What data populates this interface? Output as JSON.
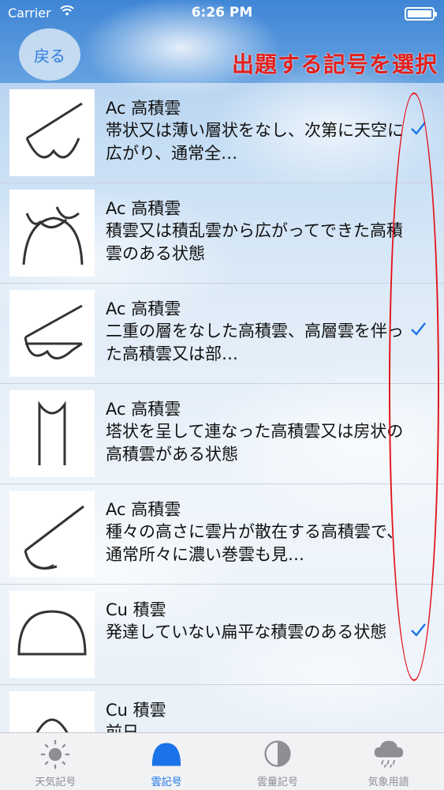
{
  "status_bar": {
    "carrier": "Carrier",
    "time": "6:26 PM",
    "battery_level": 1.0
  },
  "header": {
    "back_label": "戻る",
    "title": "出題する記号を選択"
  },
  "colors": {
    "accent": "#1a73e8",
    "title_red": "#e3201b",
    "oval_red": "#e3141a"
  },
  "items": [
    {
      "symbol": "ac-band-icon",
      "title": "Ac 高積雲",
      "description": "帯状又は薄い層状をなし、次第に天空に広がり、通常全…",
      "checked": true
    },
    {
      "symbol": "ac-from-cumulus-icon",
      "title": "Ac 高積雲",
      "description": "積雲又は積乱雲から広がってできた高積雲のある状態",
      "checked": false
    },
    {
      "symbol": "ac-double-layer-icon",
      "title": "Ac 高積雲",
      "description": "二重の層をなした高積雲、高層雲を伴った高積雲又は部…",
      "checked": true
    },
    {
      "symbol": "ac-castellanus-icon",
      "title": "Ac 高積雲",
      "description": "塔状を呈して連なった高積雲又は房状の高積雲がある状態",
      "checked": false
    },
    {
      "symbol": "ac-chaotic-icon",
      "title": "Ac 高積雲",
      "description": "種々の高さに雲片が散在する高積雲で、通常所々に濃い巻雲も見…",
      "checked": false
    },
    {
      "symbol": "cu-flat-icon",
      "title": "Cu 積雲",
      "description": "発達していない扁平な積雲のある状態",
      "checked": true
    },
    {
      "symbol": "cu-developed-icon",
      "title": "Cu 積雲",
      "description": "前日…",
      "checked": false
    }
  ],
  "tabs": [
    {
      "label": "天気記号",
      "icon": "sun-icon",
      "active": false
    },
    {
      "label": "雲記号",
      "icon": "cloud-dome-icon",
      "active": true
    },
    {
      "label": "雲量記号",
      "icon": "half-circle-icon",
      "active": false
    },
    {
      "label": "気象用語",
      "icon": "rain-cloud-icon",
      "active": false
    }
  ]
}
